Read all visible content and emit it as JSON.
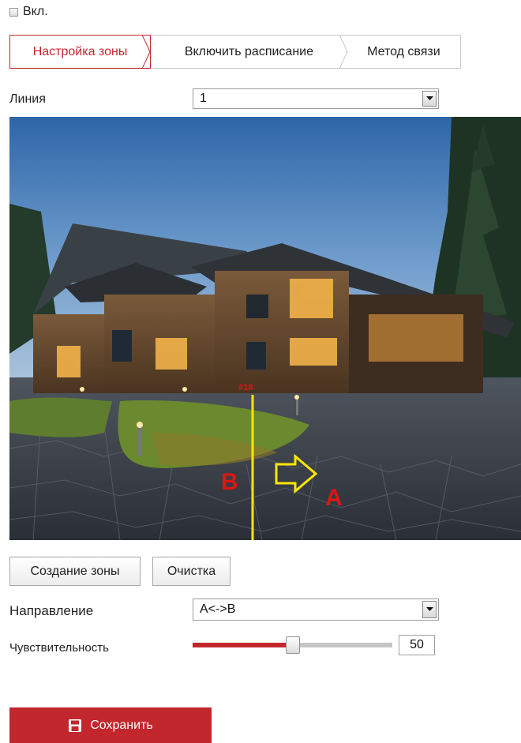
{
  "enable": {
    "label": "Вкл.",
    "checked": false
  },
  "tabs": [
    {
      "label": "Настройка зоны",
      "active": true
    },
    {
      "label": "Включить расписание",
      "active": false
    },
    {
      "label": "Метод связи",
      "active": false
    }
  ],
  "line": {
    "label": "Линия",
    "value": "1"
  },
  "video": {
    "line_label": "#18",
    "side_b": "B",
    "side_a": "A"
  },
  "buttons": {
    "create_zone": "Создание зоны",
    "clear": "Очистка"
  },
  "direction": {
    "label": "Направление",
    "value": "A<->B"
  },
  "sensitivity": {
    "label": "Чувствительность",
    "value": "50",
    "level": 0.5
  },
  "save": {
    "label": "Сохранить"
  },
  "colors": {
    "accent": "#c1272d",
    "line": "#ffe600"
  }
}
